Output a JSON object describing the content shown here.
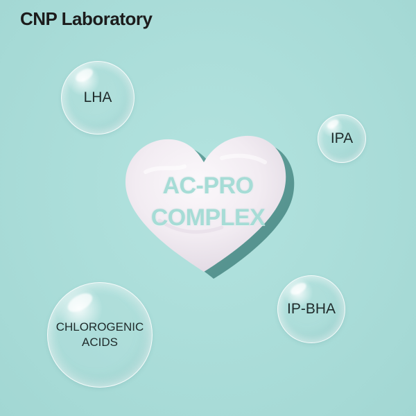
{
  "brand": {
    "name": "CNP Laboratory"
  },
  "heart": {
    "line1": "AC-PRO",
    "line2": "COMPLEX"
  },
  "bubbles": {
    "lha": "LHA",
    "ipa": "IPA",
    "ip_bha": "IP-BHA",
    "chlorogenic_line1": "CHLOROGENIC",
    "chlorogenic_line2": "ACIDS"
  },
  "colors": {
    "background": "#aadeda",
    "heart": "#f3eef4",
    "heart_shadow": "#4f8e8a",
    "heart_text": "#a6dcd6",
    "brand_text": "#1c1c1c"
  }
}
